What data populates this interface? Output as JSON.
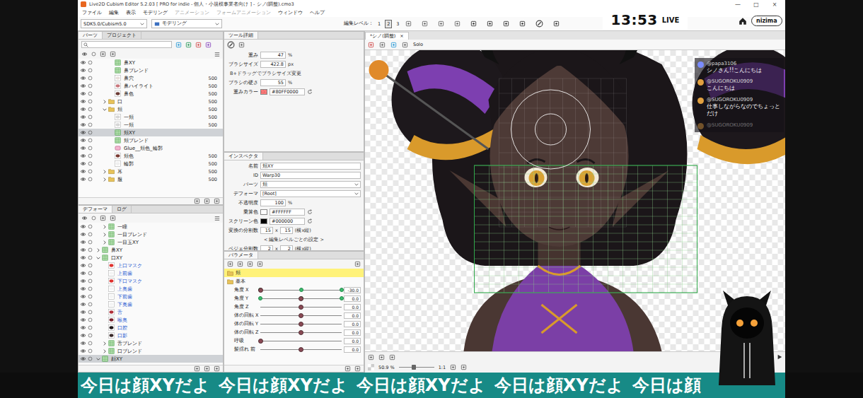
{
  "window": {
    "title": "Live2D Cubism Editor 5.2.03   [ PRO for indie - 個人・小規模事業者向け ] - シノ(調整).cmo3",
    "controls": [
      "—",
      "□",
      "×"
    ]
  },
  "menu": [
    {
      "label": "ファイル",
      "disabled": false
    },
    {
      "label": "編集",
      "disabled": false
    },
    {
      "label": "表示",
      "disabled": false
    },
    {
      "label": "モデリング",
      "disabled": false
    },
    {
      "label": "アニメーション",
      "disabled": true
    },
    {
      "label": "フォームアニメーション",
      "disabled": true
    },
    {
      "label": "ウィンドウ",
      "disabled": false
    },
    {
      "label": "ヘルプ",
      "disabled": false
    }
  ],
  "toolbar": {
    "sdk": "SDK5.0/Cubism5.0",
    "workspace": "モデリング",
    "edit_level_label": "編集レベル：",
    "edit_levels": [
      {
        "label": "1",
        "selected": false
      },
      {
        "label": "2",
        "selected": true
      },
      {
        "label": "3",
        "selected": false
      }
    ]
  },
  "parts_panel": {
    "tabs": [
      {
        "label": "パーツ",
        "selected": true
      },
      {
        "label": "プロジェクト",
        "selected": false
      }
    ],
    "rows": [
      {
        "label": "鼻XY",
        "kind": "warp",
        "indent": 2,
        "value": "",
        "selected": false,
        "visible": true
      },
      {
        "label": "鼻ブレンド",
        "kind": "warp",
        "indent": 2,
        "value": "",
        "selected": false,
        "visible": true
      },
      {
        "label": "鼻穴",
        "kind": "art",
        "indent": 2,
        "value": "500",
        "color": "#e9e0dc",
        "selected": false,
        "visible": true
      },
      {
        "label": "鼻ハイライト",
        "kind": "art",
        "indent": 2,
        "value": "500",
        "color": "#c9787e",
        "selected": false,
        "visible": true
      },
      {
        "label": "鼻色",
        "kind": "art",
        "indent": 2,
        "value": "500",
        "color": "#6b3b35",
        "selected": false,
        "visible": true
      },
      {
        "label": "口",
        "kind": "folder",
        "indent": 1,
        "value": "500",
        "expanded": false,
        "selected": false,
        "visible": true
      },
      {
        "label": "頬",
        "kind": "folder",
        "indent": 1,
        "value": "500",
        "expanded": true,
        "selected": false,
        "visible": true
      },
      {
        "label": "一頬",
        "kind": "art",
        "indent": 2,
        "value": "500",
        "color": "#d6d6d6",
        "selected": false,
        "visible": true
      },
      {
        "label": "一頬",
        "kind": "art",
        "indent": 2,
        "value": "500",
        "color": "#d6d6d6",
        "selected": false,
        "visible": true
      },
      {
        "label": "頬XY",
        "kind": "warp",
        "indent": 2,
        "value": "",
        "selected": true,
        "visible": true
      },
      {
        "label": "頬ブレンド",
        "kind": "warp",
        "indent": 2,
        "value": "",
        "selected": false,
        "visible": true
      },
      {
        "label": "Glue__頬色_輪郭",
        "kind": "glue",
        "indent": 2,
        "value": "",
        "selected": false,
        "visible": true
      },
      {
        "label": "頬色",
        "kind": "art",
        "indent": 2,
        "value": "500",
        "color": "#7a3a33",
        "selected": false,
        "visible": true
      },
      {
        "label": "輪郭",
        "kind": "art",
        "indent": 2,
        "value": "500",
        "color": "#eeeeee",
        "selected": false,
        "visible": true
      },
      {
        "label": "耳",
        "kind": "folder",
        "indent": 1,
        "value": "500",
        "expanded": false,
        "selected": false,
        "visible": true
      },
      {
        "label": "服",
        "kind": "folder",
        "indent": 1,
        "value": "500",
        "expanded": false,
        "selected": false,
        "visible": true
      }
    ]
  },
  "deformer_panel": {
    "tabs": [
      {
        "label": "デフォーマ",
        "selected": true
      },
      {
        "label": "ログ",
        "selected": false
      }
    ],
    "rows": [
      {
        "label": "一瞳",
        "kind": "warp",
        "indent": 1,
        "expanded": false,
        "selected": false,
        "visible": true
      },
      {
        "label": "一目ブレンド",
        "kind": "warp",
        "indent": 1,
        "expanded": false,
        "selected": false,
        "visible": true
      },
      {
        "label": "一目玉XY",
        "kind": "warp",
        "indent": 1,
        "expanded": false,
        "selected": false,
        "visible": true
      },
      {
        "label": "鼻XY",
        "kind": "warp",
        "indent": 0,
        "expanded": false,
        "selected": false,
        "visible": true
      },
      {
        "label": "口XY",
        "kind": "warp",
        "indent": 0,
        "expanded": true,
        "selected": false,
        "visible": true
      },
      {
        "label": "上口マスク",
        "kind": "art",
        "indent": 1,
        "color": "#e0322e",
        "selected": false,
        "visible": true
      },
      {
        "label": "上前歯",
        "kind": "art",
        "indent": 1,
        "color": "#f4f4f4",
        "selected": false,
        "visible": true
      },
      {
        "label": "下口マスク",
        "kind": "art",
        "indent": 1,
        "color": "#e0322e",
        "selected": false,
        "visible": true
      },
      {
        "label": "上奥歯",
        "kind": "art",
        "indent": 1,
        "color": "#f4f4f4",
        "selected": false,
        "visible": true
      },
      {
        "label": "下前歯",
        "kind": "art",
        "indent": 1,
        "color": "#f4f4f4",
        "selected": false,
        "visible": true
      },
      {
        "label": "下奥歯",
        "kind": "art",
        "indent": 1,
        "color": "#f4f4f4",
        "selected": false,
        "visible": true
      },
      {
        "label": "舌",
        "kind": "art",
        "indent": 1,
        "color": "#b0303a",
        "selected": false,
        "visible": true
      },
      {
        "label": "喉奥",
        "kind": "art",
        "indent": 1,
        "color": "#7a1f2a",
        "selected": false,
        "visible": true
      },
      {
        "label": "口腔",
        "kind": "art",
        "indent": 1,
        "color": "#1c1416",
        "selected": false,
        "visible": true
      },
      {
        "label": "口影",
        "kind": "art",
        "indent": 1,
        "color": "#3a2a2a",
        "selected": false,
        "visible": true
      },
      {
        "label": "舌ブレンド",
        "kind": "warp",
        "indent": 1,
        "expanded": false,
        "selected": false,
        "visible": true
      },
      {
        "label": "口ブレンド",
        "kind": "warp",
        "indent": 1,
        "expanded": false,
        "selected": false,
        "visible": true
      },
      {
        "label": "顔XY",
        "kind": "warp",
        "indent": 0,
        "expanded": true,
        "selected": true,
        "visible": true
      }
    ]
  },
  "tool_detail": {
    "title": "ツール詳細",
    "fields": [
      {
        "kind": "number",
        "label": "重み",
        "value": "47",
        "unit": "%"
      },
      {
        "kind": "number",
        "label": "ブラシサイズ",
        "value": "422.8",
        "unit": "px"
      },
      {
        "kind": "note",
        "label": "B+ドラッグでブラシサイズ変更"
      },
      {
        "kind": "number",
        "label": "ブラシの硬さ",
        "value": "55",
        "unit": "%"
      },
      {
        "kind": "color",
        "label": "重みカラー",
        "value": "#80FF0000"
      }
    ]
  },
  "inspector": {
    "title": "インスペクタ",
    "fields": [
      {
        "kind": "text",
        "label": "名前",
        "value": "頬XY"
      },
      {
        "kind": "text",
        "label": "ID",
        "value": "Warp30"
      },
      {
        "kind": "select",
        "label": "パーツ",
        "value": "頬"
      },
      {
        "kind": "select",
        "label": "デフォーマ",
        "value": "[Root]"
      },
      {
        "kind": "number",
        "label": "不透明度",
        "value": "100",
        "unit": "%"
      },
      {
        "kind": "color",
        "label": "乗算色",
        "value": "#FFFFFF"
      },
      {
        "kind": "color",
        "label": "スクリーン色",
        "value": "#000000"
      },
      {
        "kind": "division",
        "label": "変換の分割数",
        "x": "15",
        "sep": "x",
        "y": "15",
        "note": "(横x縦)"
      },
      {
        "kind": "section",
        "label": "< 編集レベルごとの設定 >"
      },
      {
        "kind": "division",
        "label": "ベジェ分割数",
        "x": "2",
        "sep": "x",
        "y": "2",
        "note": "(横x縦)"
      }
    ]
  },
  "parameters": {
    "title": "パラメータ",
    "rows": [
      {
        "kind": "group",
        "label": "頬",
        "highlight": true
      },
      {
        "kind": "group",
        "label": "基本",
        "highlight": false
      },
      {
        "kind": "slider",
        "label": "角度 X",
        "value": "-30.0",
        "level": 0,
        "keys": [
          0,
          0.5,
          1
        ]
      },
      {
        "kind": "slider",
        "label": "角度 Y",
        "value": "0.0",
        "level": 0.5,
        "keys": [
          0,
          0.5,
          1
        ]
      },
      {
        "kind": "slider",
        "label": "角度 Z",
        "value": "0.0",
        "level": 0.5,
        "keys": []
      },
      {
        "kind": "slider",
        "label": "体の回転 X",
        "value": "0.0",
        "level": 0.5,
        "keys": []
      },
      {
        "kind": "slider",
        "label": "体の回転 Y",
        "value": "0.0",
        "level": 0.5,
        "keys": []
      },
      {
        "kind": "slider",
        "label": "体の回転 Z",
        "value": "0.0",
        "level": 0.5,
        "keys": []
      },
      {
        "kind": "slider",
        "label": "呼吸",
        "value": "0.0",
        "level": 0,
        "keys": []
      },
      {
        "kind": "slider",
        "label": "髪揺れ 前",
        "value": "0.0",
        "level": 0.5,
        "keys": []
      }
    ]
  },
  "canvas": {
    "tab": "*シノ(調整)",
    "close": "×",
    "solo": "Solo",
    "zoom": "50.9 %",
    "ratio": "1:1"
  },
  "stream": {
    "clock": "13:53",
    "live": "LIVE",
    "brand": "nizima",
    "ticker": [
      "今日は顔XYだよ",
      "今日は顔XYだよ",
      "今日は顔XYだよ",
      "今日は顔XYだよ",
      "今日は顔"
    ]
  },
  "chat": [
    {
      "user": "@papa3106",
      "text": "シノさん!!こんにちは",
      "color": "#7a8cff",
      "faded": false
    },
    {
      "user": "@SUGOROKU0909",
      "text": "こんにちは",
      "color": "#e0a040",
      "faded": false
    },
    {
      "user": "@SUGOROKU0909",
      "text": "仕事しながらなのでちょっとだけ",
      "color": "#e0a040",
      "faded": false
    },
    {
      "user": "@SUGOROKU0909",
      "text": "",
      "color": "#e0a040",
      "faded": true
    }
  ]
}
